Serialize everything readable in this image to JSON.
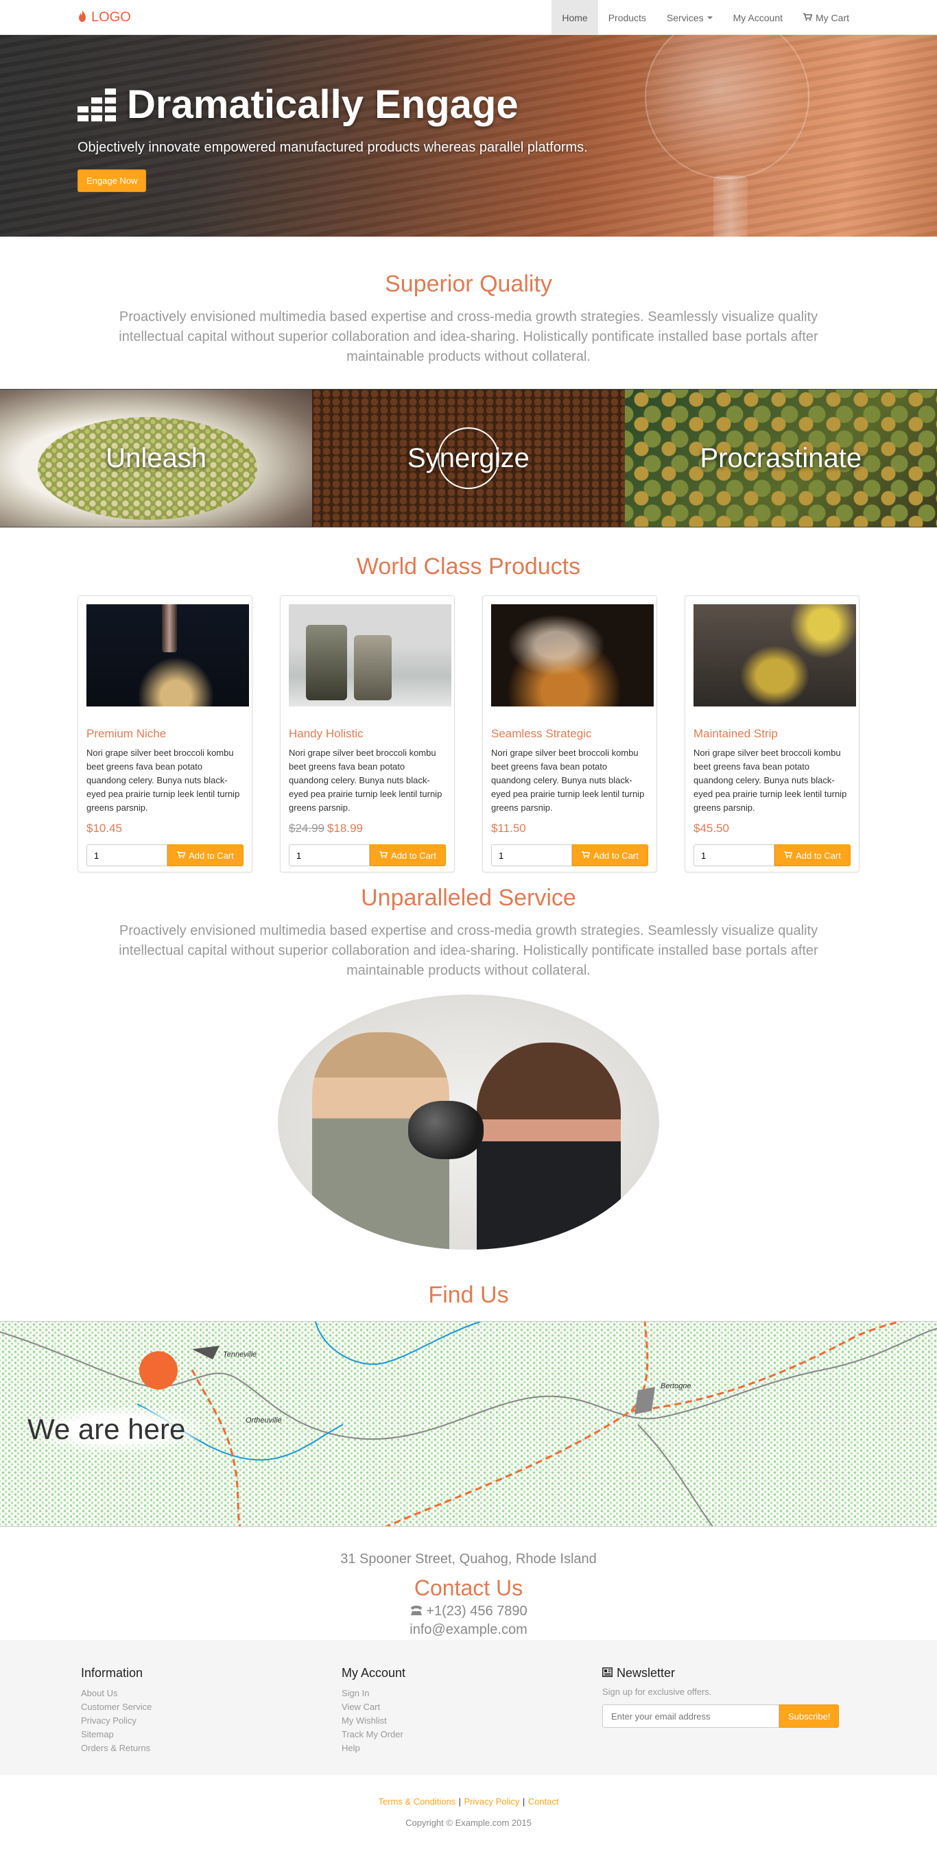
{
  "nav": {
    "logo_text": "LOGO",
    "logo_icon": "fire-icon",
    "items": [
      {
        "label": "Home",
        "active": true
      },
      {
        "label": "Products"
      },
      {
        "label": "Services",
        "dropdown": true
      },
      {
        "label": "My Account"
      },
      {
        "label": "My Cart",
        "icon": "shopping-cart-icon"
      }
    ]
  },
  "hero": {
    "title": "Dramatically Engage",
    "icon": "equalizer-icon",
    "subtitle": "Objectively innovate empowered manufactured products whereas parallel platforms.",
    "button_label": "Engage Now"
  },
  "quality": {
    "title": "Superior Quality",
    "text": "Proactively envisioned multimedia based expertise and cross-media growth strategies. Seamlessly visualize quality intellectual capital without superior collaboration and idea-sharing. Holistically pontificate installed base portals after maintainable products without collateral."
  },
  "strip": {
    "tiles": [
      {
        "label": "Unleash"
      },
      {
        "label": "Synergize"
      },
      {
        "label": "Procrastinate"
      }
    ]
  },
  "products": {
    "title": "World Class Products",
    "items": [
      {
        "name": "Premium Niche",
        "description": "Nori grape silver beet broccoli kombu beet greens fava bean potato quandong celery. Bunya nuts black-eyed pea prairie turnip leek lentil turnip greens parsnip.",
        "old_price": "",
        "price": "$10.45",
        "qty": "1"
      },
      {
        "name": "Handy Holistic",
        "description": "Nori grape silver beet broccoli kombu beet greens fava bean potato quandong celery. Bunya nuts black-eyed pea prairie turnip leek lentil turnip greens parsnip.",
        "old_price": "$24.99",
        "price": "$18.99",
        "qty": "1"
      },
      {
        "name": "Seamless Strategic",
        "description": "Nori grape silver beet broccoli kombu beet greens fava bean potato quandong celery. Bunya nuts black-eyed pea prairie turnip leek lentil turnip greens parsnip.",
        "old_price": "",
        "price": "$11.50",
        "qty": "1"
      },
      {
        "name": "Maintained Strip",
        "description": "Nori grape silver beet broccoli kombu beet greens fava bean potato quandong celery. Bunya nuts black-eyed pea prairie turnip leek lentil turnip greens parsnip.",
        "old_price": "",
        "price": "$45.50",
        "qty": "1"
      }
    ],
    "add_to_cart_label": "Add to Cart"
  },
  "service": {
    "title": "Unparalleled Service",
    "text": "Proactively envisioned multimedia based expertise and cross-media growth strategies. Seamlessly visualize quality intellectual capital without superior collaboration and idea-sharing. Holistically pontificate installed base portals after maintainable products without collateral."
  },
  "find": {
    "title": "Find Us",
    "map_label": "We are here",
    "map_places": [
      "Tenneville",
      "Ortheuville",
      "Bertogne"
    ],
    "address": "31 Spooner Street, Quahog, Rhode Island"
  },
  "contact": {
    "title": "Contact Us",
    "phone": "+1(23) 456 7890",
    "email": "info@example.com"
  },
  "footer": {
    "information": {
      "title": "Information",
      "links": [
        "About Us",
        "Customer Service",
        "Privacy Policy",
        "Sitemap",
        "Orders & Returns"
      ]
    },
    "account": {
      "title": "My Account",
      "links": [
        "Sign In",
        "View Cart",
        "My Wishlist",
        "Track My Order",
        "Help"
      ]
    },
    "newsletter": {
      "title": "Newsletter",
      "text": "Sign up for exclusive offers.",
      "placeholder": "Enter your email address",
      "button": "Subscribe!"
    },
    "legal": [
      "Terms & Conditions",
      "Privacy Policy",
      "Contact"
    ],
    "copyright": "Copyright © Example.com 2015"
  },
  "colors": {
    "accent": "#e07b53",
    "button": "#ffa41b",
    "marker": "#f26a32"
  }
}
